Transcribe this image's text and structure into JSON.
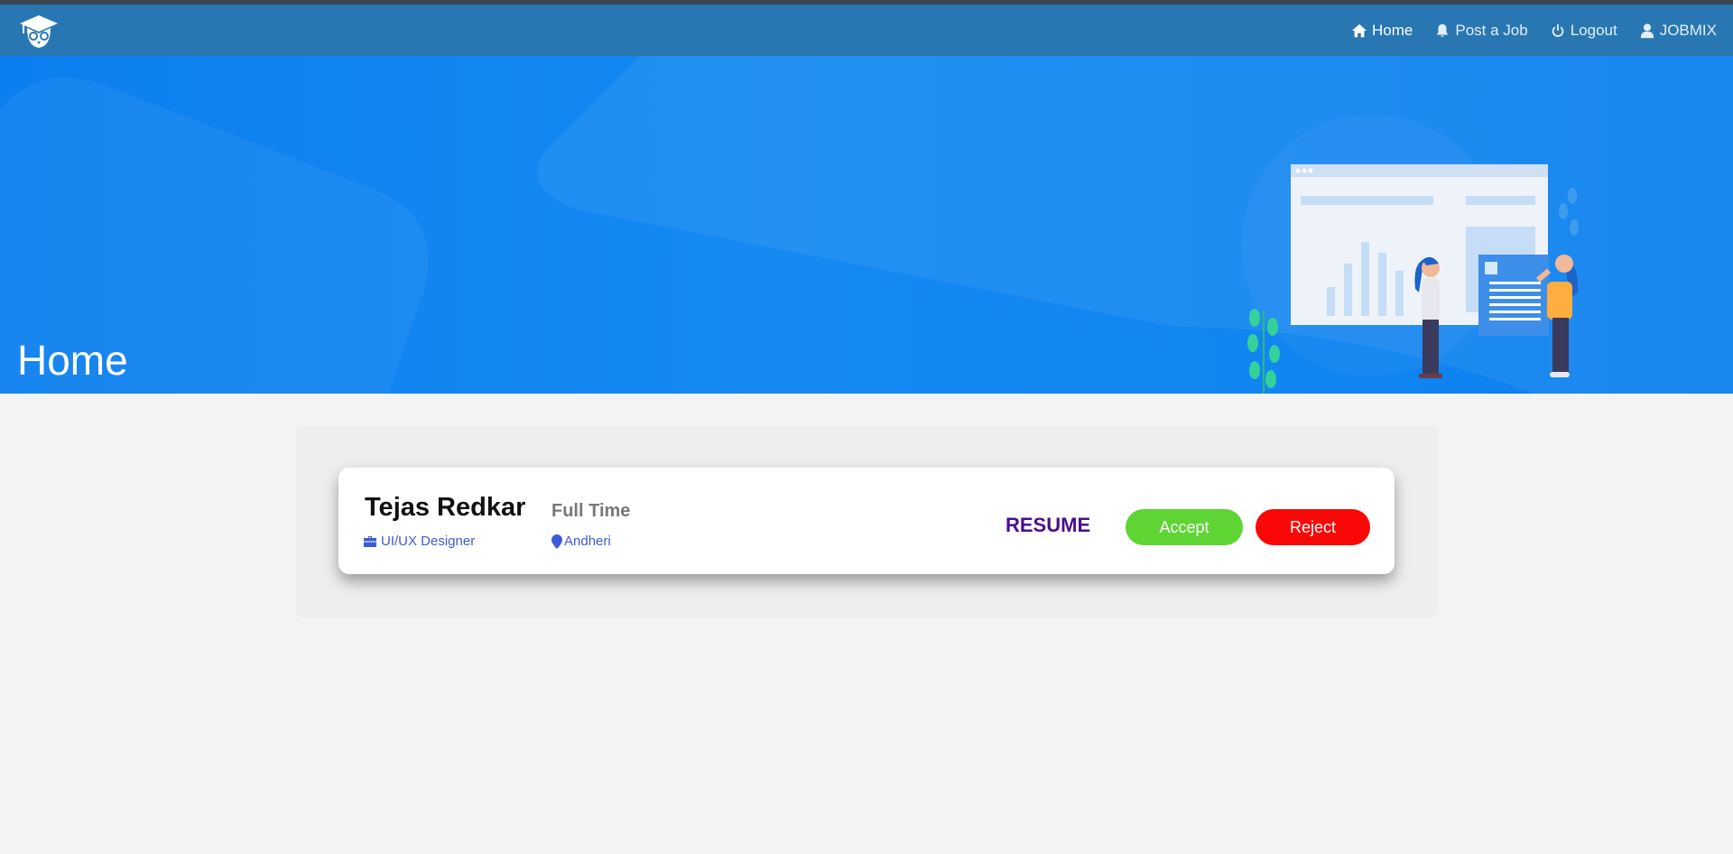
{
  "nav": {
    "logo_icon": "graduation-owl-icon",
    "links": [
      {
        "label": "Home",
        "icon": "home-icon",
        "active": true
      },
      {
        "label": "Post a Job",
        "icon": "bell-icon",
        "active": false
      },
      {
        "label": "Logout",
        "icon": "power-icon",
        "active": false
      },
      {
        "label": "JOBMIX",
        "icon": "user-icon",
        "active": false
      }
    ]
  },
  "hero": {
    "title": "Home"
  },
  "applicant": {
    "name": "Tejas Redkar",
    "job_type": "Full Time",
    "role": "UI/UX Designer",
    "role_icon": "briefcase-icon",
    "location": "Andheri",
    "location_icon": "map-marker-icon",
    "resume_label": "RESUME",
    "accept_label": "Accept",
    "reject_label": "Reject"
  },
  "colors": {
    "navbar": "#2877b2",
    "hero": "#0c80f0",
    "accept": "#5ed533",
    "reject": "#fa0707",
    "resume": "#4b0d8e",
    "meta_text": "#3c5bd6"
  }
}
